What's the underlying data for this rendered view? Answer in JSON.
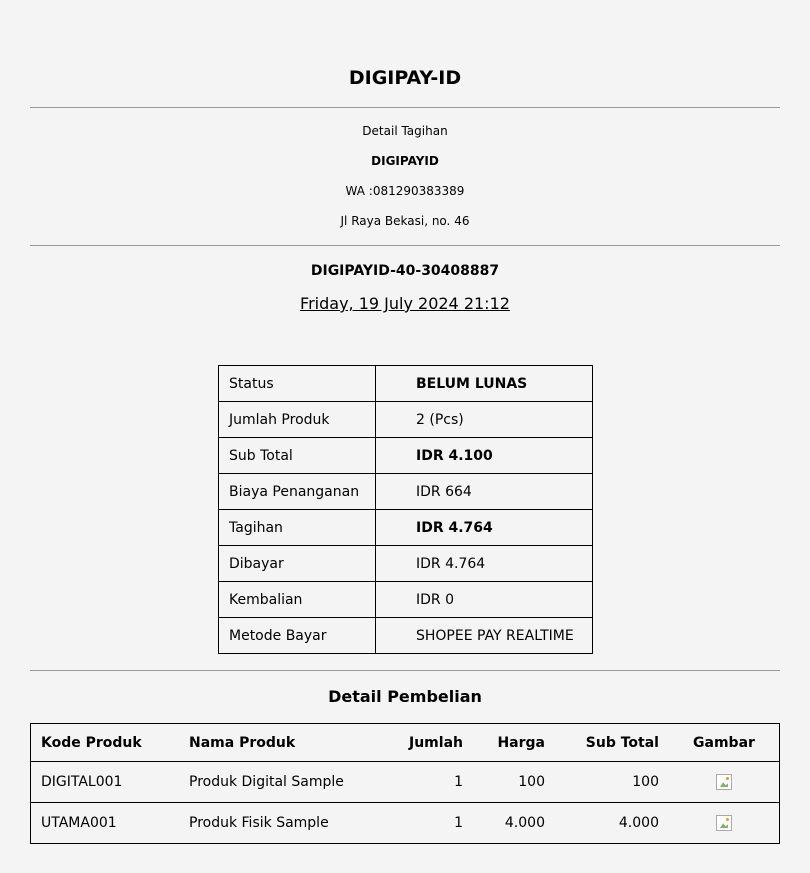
{
  "header": {
    "title": "DIGIPAY-ID",
    "subtitle": "Detail Tagihan",
    "merchant_name": "DIGIPAYID",
    "whatsapp": "WA :081290383389",
    "address": "Jl Raya Bekasi, no. 46"
  },
  "invoice": {
    "number": "DIGIPAYID-40-30408887",
    "date": "Friday, 19 July 2024 21:12"
  },
  "summary": [
    {
      "label": "Status",
      "value": "BELUM LUNAS"
    },
    {
      "label": "Jumlah Produk",
      "value": "2 (Pcs)"
    },
    {
      "label": "Sub Total",
      "value": "IDR 4.100"
    },
    {
      "label": "Biaya Penanganan",
      "value": "IDR 664"
    },
    {
      "label": "Tagihan",
      "value": "IDR 4.764"
    },
    {
      "label": "Dibayar",
      "value": "IDR 4.764"
    },
    {
      "label": "Kembalian",
      "value": "IDR 0"
    },
    {
      "label": "Metode Bayar",
      "value": "SHOPEE PAY REALTIME"
    }
  ],
  "purchase": {
    "title": "Detail Pembelian",
    "columns": [
      "Kode Produk",
      "Nama Produk",
      "Jumlah",
      "Harga",
      "Sub Total",
      "Gambar"
    ],
    "rows": [
      {
        "code": "DIGITAL001",
        "name": "Produk Digital Sample",
        "qty": "1",
        "price": "100",
        "subtotal": "100",
        "image_icon": "broken-image-icon"
      },
      {
        "code": "UTAMA001",
        "name": "Produk Fisik Sample",
        "qty": "1",
        "price": "4.000",
        "subtotal": "4.000",
        "image_icon": "broken-image-icon"
      }
    ]
  }
}
